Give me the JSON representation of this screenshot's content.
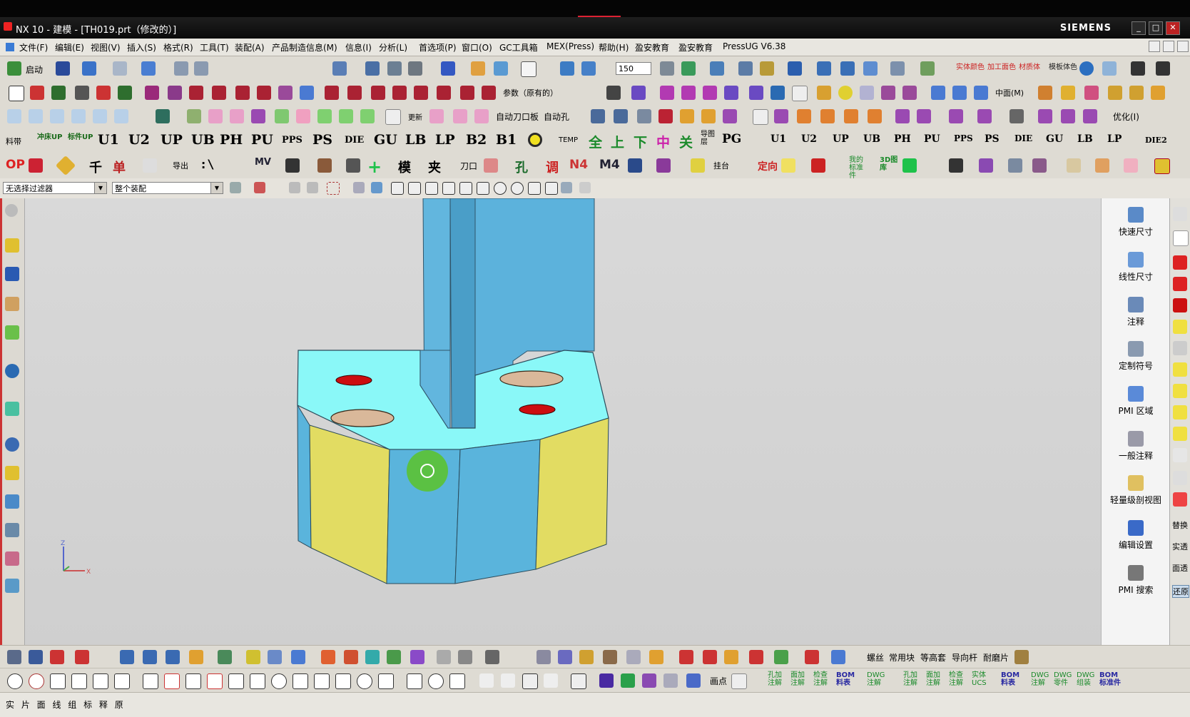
{
  "window": {
    "title": "NX 10 - 建模 - [TH019.prt（修改的）]",
    "brand": "SIEMENS",
    "min": "_",
    "max": "□",
    "close": "✕"
  },
  "menu": [
    "文件(F)",
    "编辑(E)",
    "视图(V)",
    "插入(S)",
    "格式(R)",
    "工具(T)",
    "装配(A)",
    "产品制造信息(M)",
    "信息(I)",
    "分析(L)",
    "首选项(P)",
    "窗口(O)",
    "GC工具箱",
    "MEX(Press)",
    "帮助(H)",
    "盈安教育",
    "盈安教育",
    "PressUG V6.38"
  ],
  "toolbar1": {
    "start_label": "启动",
    "zoom_value": "150",
    "labels": [
      "实体颜色",
      "加工面色",
      "材质体",
      "模板体色"
    ]
  },
  "toolbar2": {
    "labels": [
      "参数（原有的）",
      "中面(M)"
    ]
  },
  "toolbar3": {
    "labels": [
      "自动刀口板",
      "自动孔",
      "更新",
      "优化(I)"
    ]
  },
  "toolbar4": {
    "small": [
      "料带",
      "冲床UP",
      "标件UP"
    ],
    "big": [
      "U1",
      "U2",
      "UP",
      "UB",
      "PH",
      "PU",
      "PPS",
      "PS",
      "DIE",
      "GU",
      "LB",
      "LP",
      "B2",
      "B1"
    ],
    "red": [
      "上",
      "下",
      "中",
      "关"
    ],
    "right": [
      "U1",
      "U2",
      "UP",
      "UB",
      "PH",
      "PU",
      "PPS",
      "PS",
      "DIE",
      "GU",
      "LB",
      "LP",
      "DIE2"
    ],
    "pg": "PG",
    "temp": "TEMP",
    "daojian": "导图层"
  },
  "toolbar5": {
    "labels": [
      "OP",
      "导出",
      "MV",
      "模",
      "夹",
      "刀口",
      "调",
      "N4",
      "M4",
      "孔",
      "挂台",
      "定向",
      "我的标准件",
      "3D图库"
    ]
  },
  "filter": {
    "type_filter": "无选择过滤器",
    "assembly_scope": "整个装配"
  },
  "right_panel": [
    "快速尺寸",
    "线性尺寸",
    "注释",
    "定制符号",
    "PMI 区域",
    "一般注释",
    "轻量级剖视图",
    "编辑设置",
    "PMI 搜索"
  ],
  "far_right": [
    "替换",
    "实透",
    "面透",
    "还原"
  ],
  "bottom1": {
    "labels": [
      "螺丝",
      "常用块",
      "等高套",
      "导向杆",
      "耐磨片"
    ]
  },
  "bottom2": {
    "labels": [
      "画点",
      "孔加注解",
      "面加注解",
      "检查注解",
      "BOM料表",
      "DWG注解",
      "孔加注解",
      "面加注解",
      "检查注解",
      "实体UCS",
      "BOM料表",
      "DWG注解",
      "DWG零件",
      "DWG组装",
      "BOM标准件"
    ]
  },
  "status": {
    "text": "实 片 面 线 组 标 释 原"
  },
  "colors": {
    "top_face": "#8af8f8",
    "side_blue": "#5ab4dc",
    "side_yellow": "#e2dc62",
    "hole_red": "#cc0d10",
    "hole_tan": "#d9b89a",
    "cursor": "#5cc23a"
  }
}
